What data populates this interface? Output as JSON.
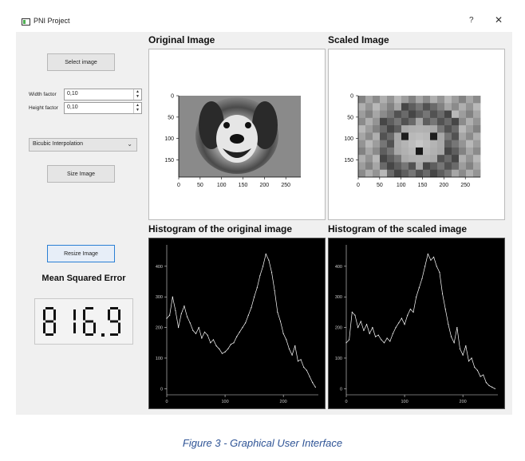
{
  "window": {
    "title": "PNI Project",
    "help_glyph": "?",
    "close_glyph": "✕"
  },
  "controls": {
    "select_image_label": "Select image",
    "width_factor_label": "Width factor",
    "width_factor_value": "0,10",
    "height_factor_label": "Height factor",
    "height_factor_value": "0,10",
    "interpolation_value": "Bicubic Interpolation",
    "size_image_label": "Size Image",
    "resize_image_label": "Resize Image"
  },
  "mse": {
    "title": "Mean Squared Error",
    "value": "816.9"
  },
  "panels": {
    "original_title": "Original Image",
    "scaled_title": "Scaled Image",
    "hist_original_title": "Histogram of the original image",
    "hist_scaled_title": "Histogram of the scaled image"
  },
  "image_axes": {
    "x_ticks": [
      "0",
      "50",
      "100",
      "150",
      "200",
      "250"
    ],
    "y_ticks": [
      "0",
      "50",
      "100",
      "150"
    ]
  },
  "chart_data": [
    {
      "type": "line",
      "x_ticks": [
        "0",
        "100",
        "200"
      ],
      "y_ticks": [
        "0",
        "100",
        "200",
        "300",
        "400"
      ],
      "xlim": [
        0,
        260
      ],
      "ylim": [
        -20,
        470
      ],
      "x": [
        0,
        5,
        10,
        15,
        20,
        25,
        30,
        35,
        40,
        45,
        50,
        55,
        60,
        65,
        70,
        75,
        80,
        85,
        90,
        95,
        100,
        105,
        110,
        115,
        120,
        125,
        130,
        135,
        140,
        145,
        150,
        155,
        160,
        165,
        170,
        175,
        180,
        185,
        190,
        195,
        200,
        205,
        210,
        215,
        220,
        225,
        230,
        235,
        240,
        245,
        250,
        255
      ],
      "values": [
        230,
        240,
        300,
        255,
        200,
        245,
        270,
        235,
        215,
        190,
        180,
        200,
        165,
        185,
        175,
        150,
        160,
        140,
        130,
        115,
        120,
        130,
        145,
        150,
        170,
        185,
        200,
        215,
        240,
        265,
        300,
        330,
        370,
        400,
        440,
        420,
        380,
        320,
        250,
        220,
        180,
        160,
        130,
        110,
        140,
        90,
        95,
        70,
        60,
        40,
        20,
        5
      ]
    },
    {
      "type": "line",
      "x_ticks": [
        "0",
        "100",
        "200"
      ],
      "y_ticks": [
        "0",
        "100",
        "200",
        "300",
        "400"
      ],
      "xlim": [
        0,
        260
      ],
      "ylim": [
        -20,
        470
      ],
      "x": [
        0,
        5,
        10,
        15,
        20,
        25,
        30,
        35,
        40,
        45,
        50,
        55,
        60,
        65,
        70,
        75,
        80,
        85,
        90,
        95,
        100,
        105,
        110,
        115,
        120,
        125,
        130,
        135,
        140,
        145,
        150,
        155,
        160,
        165,
        170,
        175,
        180,
        185,
        190,
        195,
        200,
        205,
        210,
        215,
        220,
        225,
        230,
        235,
        240,
        245,
        250,
        255
      ],
      "values": [
        150,
        160,
        250,
        240,
        200,
        220,
        190,
        210,
        180,
        200,
        170,
        175,
        160,
        150,
        165,
        155,
        180,
        200,
        215,
        230,
        210,
        240,
        260,
        250,
        300,
        330,
        360,
        400,
        440,
        420,
        430,
        400,
        380,
        310,
        260,
        210,
        170,
        150,
        200,
        130,
        110,
        140,
        90,
        100,
        70,
        60,
        40,
        45,
        20,
        10,
        5,
        0
      ]
    }
  ],
  "caption": "Figure 3 - Graphical User Interface"
}
